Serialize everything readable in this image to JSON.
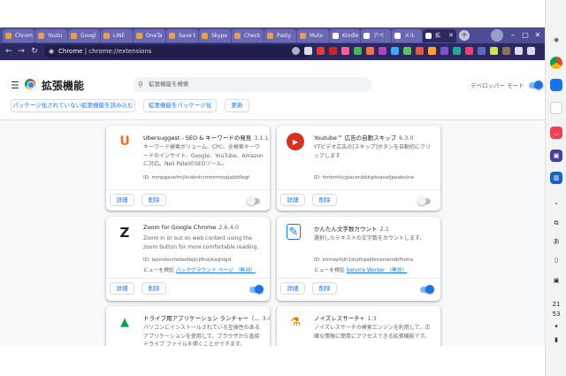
{
  "tabs": [
    {
      "label": "Chrom",
      "color": "#e9a23b"
    },
    {
      "label": "Youtu",
      "color": "#e9a23b"
    },
    {
      "label": "Googl",
      "color": "#e9a23b"
    },
    {
      "label": "LINE",
      "color": "#e9a23b"
    },
    {
      "label": "OneTa",
      "color": "#e9a23b"
    },
    {
      "label": "Save t",
      "color": "#e9a23b"
    },
    {
      "label": "Skype",
      "color": "#e9a23b"
    },
    {
      "label": "Check",
      "color": "#e9a23b"
    },
    {
      "label": "Pasty",
      "color": "#e9a23b"
    },
    {
      "label": "Mute",
      "color": "#e9a23b"
    },
    {
      "label": "Kindle",
      "color": "#ffffff"
    },
    {
      "label": "アペ",
      "color": "#ffffff"
    },
    {
      "label": "メル",
      "color": "#ffffff"
    },
    {
      "label": "拡",
      "color": "#ffffff"
    }
  ],
  "toolbar": {
    "url_host": "Chrome",
    "url_sep": " | ",
    "url_path": "chrome://extensions"
  },
  "header": {
    "title": "拡張機能",
    "search_placeholder": "拡張機能を検索",
    "devmode_label": "デベロッパー モード",
    "devmode_on": true
  },
  "actions": {
    "load_unpacked": "パッケージ化されていない拡張機能を読み込む",
    "pack": "拡張機能をパッケージ化",
    "update": "更新"
  },
  "cards": [
    {
      "name": "Ubersuggest - SEO & キーワードの発見",
      "version": "3.1.1",
      "desc": "キーワード検索ボリューム、CPC、全検索キーワードのインサイト、Google、YouTube、Amazon に対応。Neil PatelのSEOツール。",
      "id": "ID: mmpgaoofmjlinabnhcmmmnopjabbflegf",
      "view": "",
      "view_link": "",
      "details": "詳細",
      "remove": "削除",
      "enabled": false,
      "icon": "ubersuggest-icon",
      "icon_text": "U",
      "icon_color": "#f26a23"
    },
    {
      "name": "Youtube™ 広告の自動スキップ",
      "version": "6.3.0",
      "desc": "YTビデオ広告の[スキップ]ボタンを自動的にクリックします",
      "id": "ID: hmbnhhcgiecenbbkgdoaoafjpeaboine",
      "view": "",
      "view_link": "",
      "details": "詳細",
      "remove": "削除",
      "enabled": false,
      "icon": "shield-icon",
      "icon_text": "▶",
      "icon_color": "#d93025"
    },
    {
      "name": "Zoom for Google Chrome",
      "version": "2.6.4.0",
      "desc": "Zoom in or out on web content using the zoom button for more comfortable reading.",
      "id": "ID: lajondecmobodlejlcjllhojikagldgd",
      "view": "ビューを検証",
      "view_link": "バックグラウンド ページ （無効）",
      "details": "詳細",
      "remove": "削除",
      "enabled": true,
      "icon": "zoom-icon",
      "icon_text": "Z",
      "icon_color": "#202124"
    },
    {
      "name": "かんたん文字数カウント",
      "version": "2.1",
      "desc": "選択したテキストの文字数をカウントします。",
      "id": "ID: lmmephjlh1dnjfiigajlbmenwndbfhnha",
      "view": "ビューを検証",
      "view_link": "Service Worker （無効）",
      "details": "詳細",
      "remove": "削除",
      "enabled": true,
      "icon": "document-edit-icon",
      "icon_text": "✎",
      "icon_color": "#1a73e8"
    },
    {
      "name": "ドライブ用アプリケーション ランチャー（...",
      "version": "3.4",
      "desc": "パソコンにインストールされている互換性のあるアプリケーションを使用して、ブラウザから直接ドライブ ファイルを開くことができます。",
      "id": "",
      "view": "",
      "view_link": "",
      "details": "",
      "remove": "",
      "enabled": true,
      "icon": "drive-icon",
      "icon_text": "▲",
      "icon_color": "#0f9d58"
    },
    {
      "name": "ノイズレスサーチ+",
      "version": "1.3",
      "desc": "ノイズレスサーチの検索エンジンを利用して、正確な情報に簡単にアクセスできる拡張機能です。",
      "id": "",
      "view": "",
      "view_link": "",
      "details": "",
      "remove": "",
      "enabled": true,
      "icon": "flask-icon",
      "icon_text": "⚗",
      "icon_color": "#e8710a"
    }
  ],
  "shelf": {
    "clock_hour": "21",
    "clock_min": "53"
  },
  "colors": {
    "tabstrip": "#4e4c95",
    "toolbar": "#2b2a60",
    "accent": "#1a73e8"
  }
}
